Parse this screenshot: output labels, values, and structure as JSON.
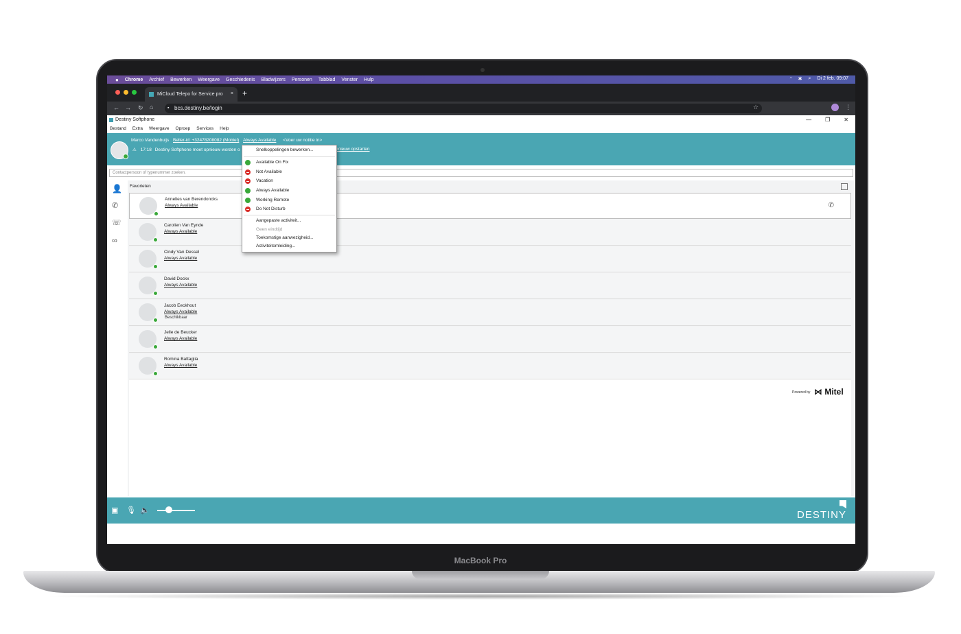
{
  "device": {
    "label": "MacBook Pro"
  },
  "mac_menu": {
    "apple": "",
    "items": [
      "Chrome",
      "Archief",
      "Bewerken",
      "Weergave",
      "Geschiedenis",
      "Bladwijzers",
      "Personen",
      "Tabblad",
      "Venster",
      "Hulp"
    ],
    "clock": "Di 2 feb.  09:07"
  },
  "browser": {
    "tab_title": "MiCloud Telepo for Service pro",
    "url": "bcs.destiny.be/login",
    "new_tab": "+",
    "tab_close": "×"
  },
  "app": {
    "title": "Destiny Softphone",
    "menu": [
      "Bestand",
      "Extra",
      "Weergave",
      "Oproep",
      "Services",
      "Help"
    ],
    "user": {
      "name": "Marco Vandenbuijs",
      "caller_id": "Beller-id: +32478208082 (Mobiel)",
      "status": "Always Available",
      "note": "<Voer uw notitie in>"
    },
    "warning": {
      "time": "17:18",
      "text": "Destiny Softphone moet opnieuw worden o",
      "link": "pnieuw opstarten"
    },
    "search_placeholder": "Contactpersoon of typenummer zoeken.",
    "favorites_label": "Favorieten",
    "contacts": [
      {
        "name": "Annelies van Berendoncks",
        "status": "Always Available"
      },
      {
        "name": "Carolien Van Eynde",
        "status": "Always Available"
      },
      {
        "name": "Cindy Van Dessel",
        "status": "Always Available"
      },
      {
        "name": "David Dockx",
        "status": "Always Available"
      },
      {
        "name": "Jacob Eeckhout",
        "status": "Always Available",
        "extra": "Beschikbaar"
      },
      {
        "name": "Jelle de Beucker",
        "status": "Always Available"
      },
      {
        "name": "Romina Battaglia",
        "status": "Always Available"
      }
    ],
    "powered_by": "Powered by",
    "mitel": "Mitel",
    "destiny_logo": "DESTINY",
    "volume_level": 0.3
  },
  "status_menu": {
    "edit_shortcuts": "Snelkoppelingen bewerken...",
    "statuses": [
      {
        "label": "Available On Fix",
        "color": "#3aa83a"
      },
      {
        "label": "Not Available",
        "color": "#d9302c"
      },
      {
        "label": "Vacation",
        "color": "#d9302c"
      },
      {
        "label": "Always Available",
        "color": "#3aa83a"
      },
      {
        "label": "Working Remote",
        "color": "#3aa83a"
      },
      {
        "label": "Do Not Disturb",
        "color": "#d9302c"
      }
    ],
    "custom_activity": "Aangepaste activiteit...",
    "no_end_time": "Geen eindtijd",
    "future_presence": "Toekomstige aanwezigheid...",
    "activity_redirect": "Activiteitomleiding..."
  }
}
